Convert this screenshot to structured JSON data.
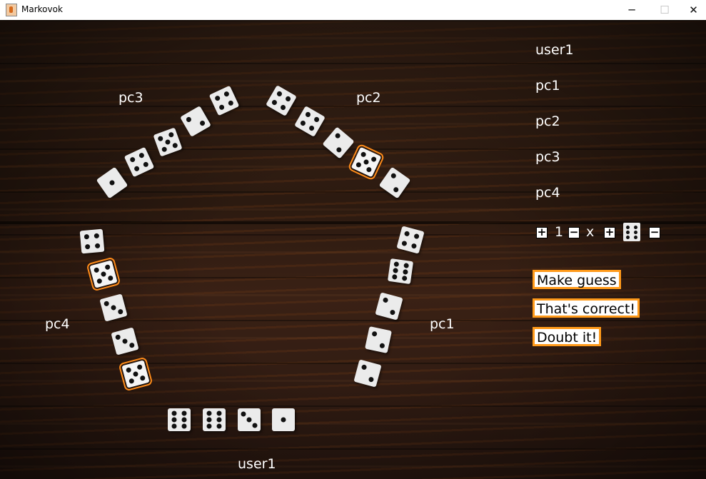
{
  "window": {
    "title": "Markovok",
    "minimize": "─",
    "maximize": "☐",
    "close": "✕"
  },
  "players": {
    "pc3": "pc3",
    "pc2": "pc2",
    "pc4": "pc4",
    "pc1": "pc1",
    "user1": "user1"
  },
  "scoreboard": [
    "user1",
    "pc1",
    "pc2",
    "pc3",
    "pc4"
  ],
  "guess": {
    "count": "1",
    "times": "x",
    "face": 6,
    "plus": "+",
    "minus": "−"
  },
  "buttons": {
    "make_guess": "Make guess",
    "correct": "That's correct!",
    "doubt": "Doubt it!"
  },
  "dice": {
    "pc3": [
      1,
      4,
      5,
      2,
      4
    ],
    "pc2": [
      4,
      4,
      2,
      5,
      2
    ],
    "pc1": [
      4,
      6,
      2,
      2,
      2
    ],
    "pc4": [
      4,
      5,
      3,
      3,
      5
    ],
    "user1": [
      6,
      6,
      3,
      1
    ]
  },
  "highlighted": {
    "pc2": [
      3
    ],
    "pc4": [
      1,
      4
    ]
  },
  "colors": {
    "accent": "#ff9a1a",
    "die": "#ebebeb",
    "text": "#ffffff"
  }
}
